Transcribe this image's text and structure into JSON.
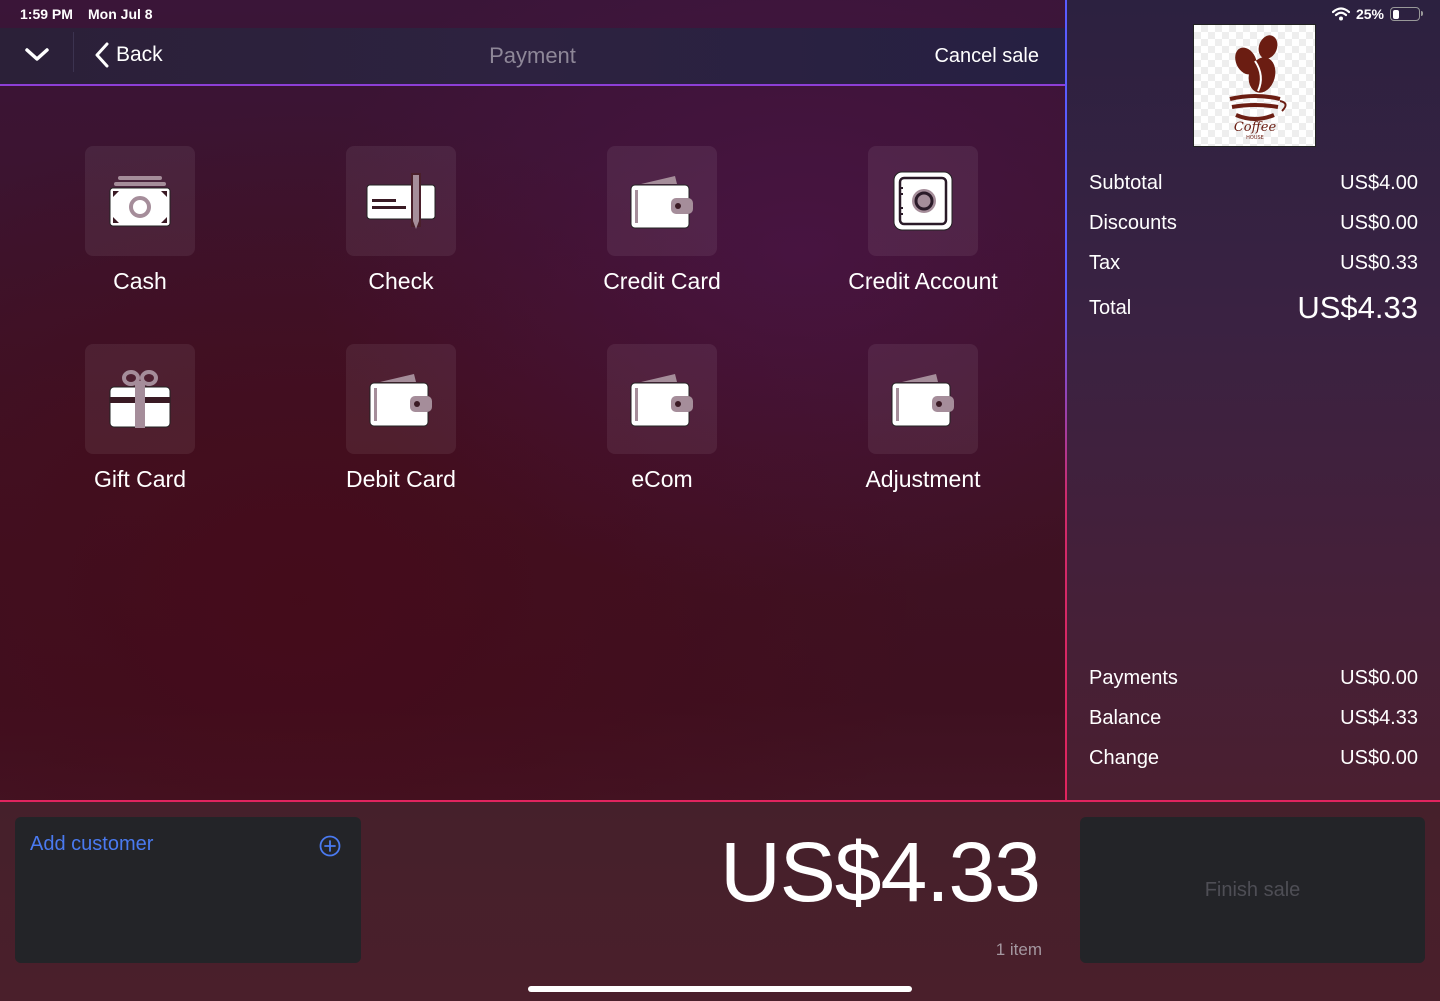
{
  "status_bar": {
    "time": "1:59 PM",
    "date": "Mon Jul 8",
    "battery": "25%",
    "battery_level": 0.25
  },
  "nav": {
    "back_label": "Back",
    "title": "Payment",
    "cancel_label": "Cancel sale"
  },
  "payment_methods": [
    {
      "label": "Cash",
      "icon": "cash-icon"
    },
    {
      "label": "Check",
      "icon": "check-icon"
    },
    {
      "label": "Credit Card",
      "icon": "wallet-icon"
    },
    {
      "label": "Credit Account",
      "icon": "safe-icon"
    },
    {
      "label": "Gift Card",
      "icon": "gift-icon"
    },
    {
      "label": "Debit Card",
      "icon": "wallet-icon"
    },
    {
      "label": "eCom",
      "icon": "wallet-icon"
    },
    {
      "label": "Adjustment",
      "icon": "wallet-icon"
    }
  ],
  "logo": {
    "text": "Coffee",
    "subtext": "HOUSE"
  },
  "summary": {
    "subtotal": {
      "label": "Subtotal",
      "value": "US$4.00"
    },
    "discounts": {
      "label": "Discounts",
      "value": "US$0.00"
    },
    "tax": {
      "label": "Tax",
      "value": "US$0.33"
    },
    "total": {
      "label": "Total",
      "value": "US$4.33"
    },
    "payments": {
      "label": "Payments",
      "value": "US$0.00"
    },
    "balance": {
      "label": "Balance",
      "value": "US$4.33"
    },
    "change": {
      "label": "Change",
      "value": "US$0.00"
    }
  },
  "bottom": {
    "add_customer_label": "Add customer",
    "amount": "US$4.33",
    "items_count": "1 item",
    "finish_label": "Finish sale"
  },
  "colors": {
    "accent_blue": "#4a7af0",
    "divider_pink": "#e0245e",
    "nav_underline": "#8d3fd6"
  }
}
